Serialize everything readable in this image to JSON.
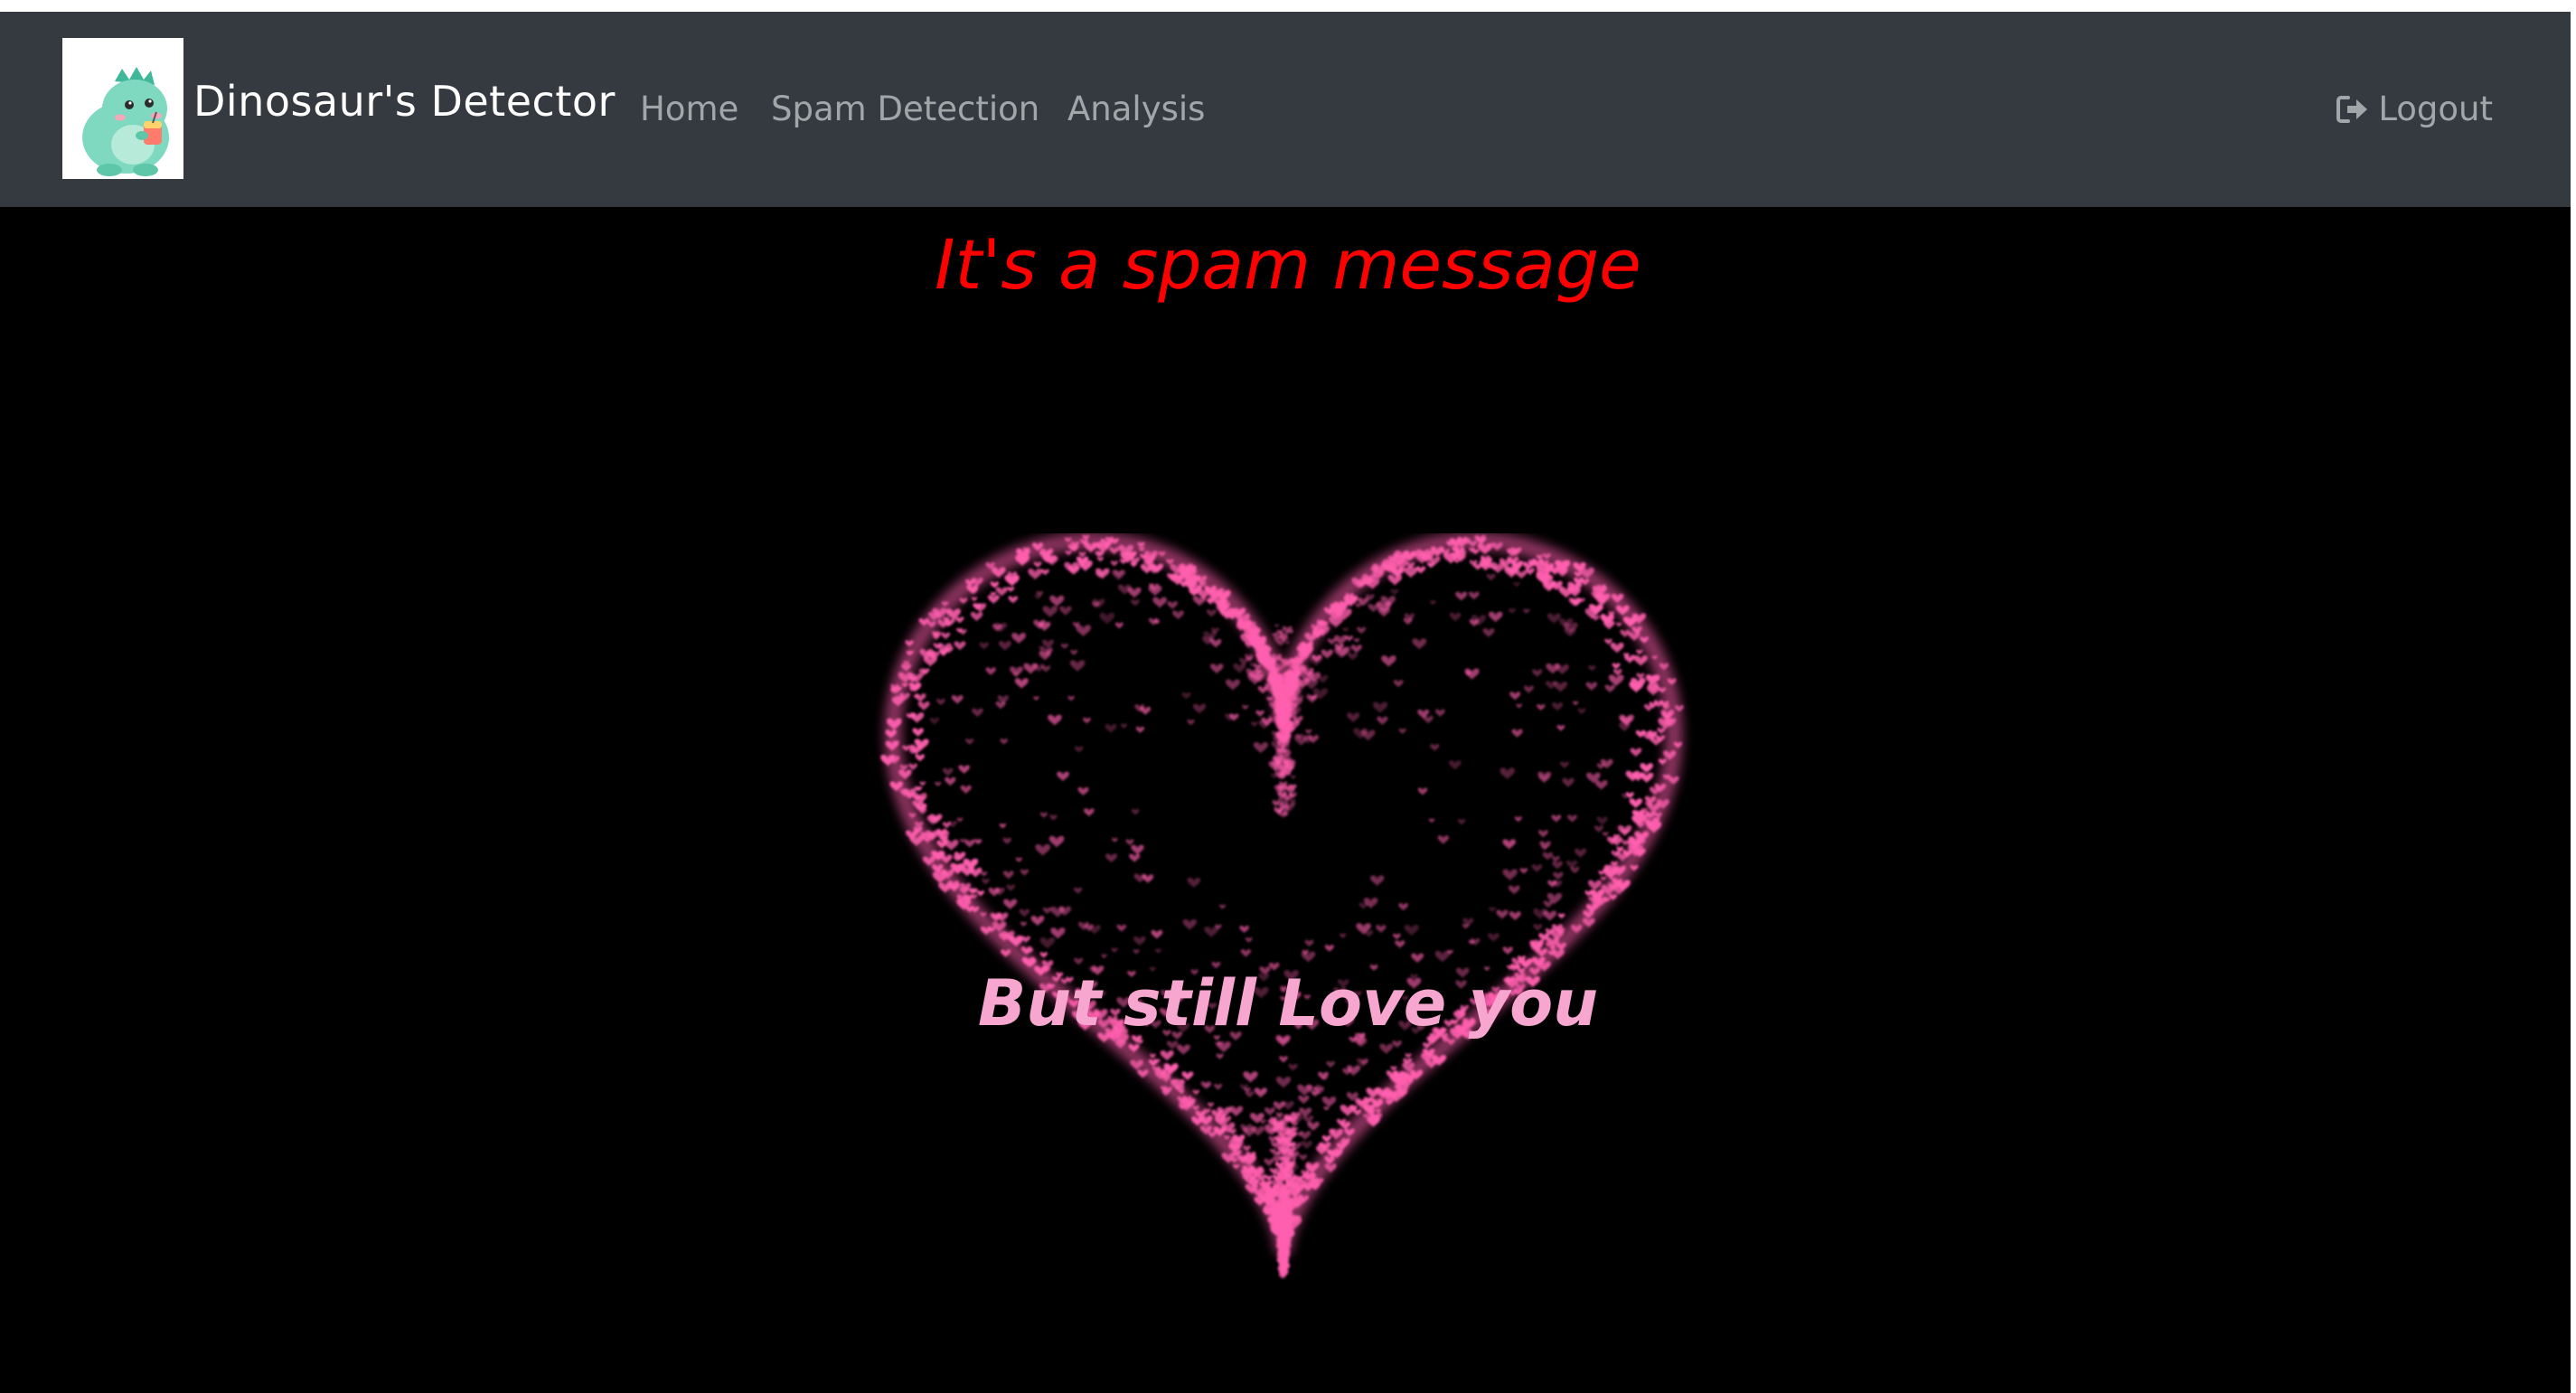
{
  "navbar": {
    "brand": "Dinosaur's Detector",
    "logo_icon": "dinosaur-mascot-icon",
    "links": [
      {
        "label": "Home"
      },
      {
        "label": "Spam Detection"
      },
      {
        "label": "Analysis"
      }
    ],
    "logout_label": "Logout",
    "logout_icon": "sign-out-icon",
    "background": "#343a40"
  },
  "main": {
    "headline": "It's a spam message",
    "headline_color": "#ff0000",
    "heart_icon": "particle-heart-icon",
    "heart_color": "#ff5fae",
    "heart_message": "But still Love you",
    "background": "#000000"
  }
}
